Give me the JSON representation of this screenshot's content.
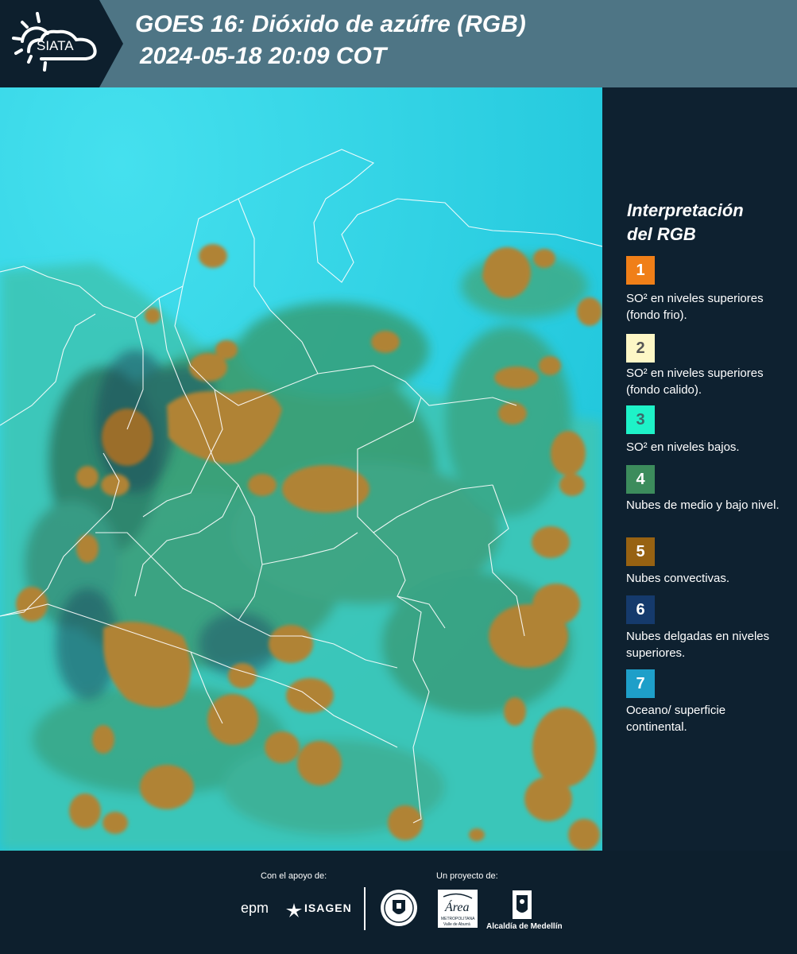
{
  "header": {
    "logo_text": "SIATA",
    "title_line1": "GOES 16: Dióxido de azúfre (RGB)",
    "title_line2": "2024-05-18 20:09 COT"
  },
  "legend": {
    "title_line1": "Interpretación",
    "title_line2": "del RGB",
    "items": [
      {
        "num": "1",
        "color": "#f07f18",
        "num_color": "#ffffff",
        "text": "SO² en niveles superiores (fondo frio)."
      },
      {
        "num": "2",
        "color": "#fdf7c6",
        "num_color": "#555555",
        "text": "SO² en niveles superiores (fondo calido)."
      },
      {
        "num": "3",
        "color": "#1ef2c8",
        "num_color": "#3a6a6a",
        "text": "SO² en niveles bajos."
      },
      {
        "num": "4",
        "color": "#3c8c5c",
        "num_color": "#ffffff",
        "text": "Nubes de medio y bajo nivel."
      },
      {
        "num": "5",
        "color": "#976212",
        "num_color": "#ffffff",
        "text": "Nubes convectivas."
      },
      {
        "num": "6",
        "color": "#153a6c",
        "num_color": "#ffffff",
        "text": "Nubes delgadas en niveles superiores."
      },
      {
        "num": "7",
        "color": "#1e9fc9",
        "num_color": "#ffffff",
        "text": "Oceano/ superficie continental."
      }
    ]
  },
  "footer": {
    "support_label": "Con el apoyo de:",
    "project_label": "Un proyecto de:",
    "epm": "epm",
    "isagen": "ISAGEN",
    "area_name": "Área",
    "area_sub1": "METROPOLITANA",
    "area_sub2": "Valle de Aburrá",
    "alcaldia": "Alcaldía de Medellín"
  },
  "colors": {
    "ocean": "#2ad3e3",
    "land": "#52cbb0",
    "convective": "#b08336",
    "header": "#4e7585",
    "panel": "#0e2130"
  }
}
